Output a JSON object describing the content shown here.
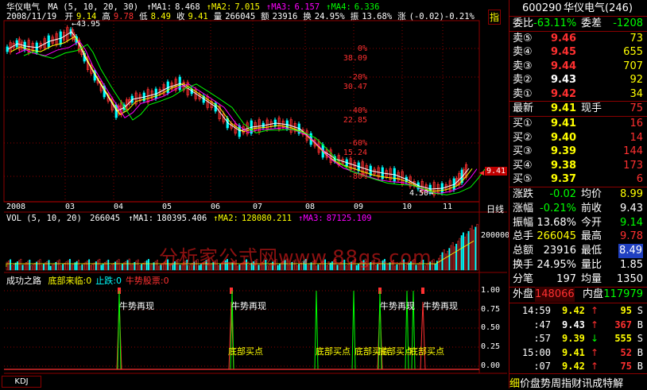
{
  "main_chart": {
    "stock_name": "华仪电气",
    "ma_label": "MA (5, 10, 20, 30)",
    "ma_values": [
      {
        "label": "MA1:",
        "value": "8.468",
        "color": "#ffffff"
      },
      {
        "label": "MA2:",
        "value": "7.015",
        "color": "#ffff00"
      },
      {
        "label": "MA3:",
        "value": "6.157",
        "color": "#ff00ff"
      },
      {
        "label": "MA4:",
        "value": "6.336",
        "color": "#00ff00"
      }
    ],
    "date": "2008/11/19",
    "ohlc": [
      {
        "label": "开",
        "value": "9.14",
        "color": "#ffff00"
      },
      {
        "label": "高",
        "value": "9.78",
        "color": "#ff3030"
      },
      {
        "label": "低",
        "value": "8.49",
        "color": "#ffff00"
      },
      {
        "label": "收",
        "value": "9.41",
        "color": "#ffff00"
      },
      {
        "label": "量",
        "value": "266045",
        "color": "#ffffff"
      },
      {
        "label": "额",
        "value": "23916",
        "color": "#ffffff"
      },
      {
        "label": "换",
        "value": "24.95%",
        "color": "#ffffff"
      },
      {
        "label": "振",
        "value": "13.68%",
        "color": "#ffffff"
      },
      {
        "label": "涨",
        "value": "(-0.02)-0.21%",
        "color": "#ffffff"
      }
    ],
    "indicator_tab": "指",
    "high_label": "43.95",
    "low_label": "4.50",
    "current_price_tag": "9.41",
    "right_axis": [
      {
        "pct": "0%",
        "price": "38.09"
      },
      {
        "pct": "-20%",
        "price": "30.47"
      },
      {
        "pct": "-40%",
        "price": "22.85"
      },
      {
        "pct": "-60%",
        "price": "15.24"
      },
      {
        "pct": "-80%",
        "price": ""
      }
    ],
    "x_labels": [
      "2008",
      "03",
      "04",
      "05",
      "06",
      "07",
      "08",
      "09",
      "10",
      "11"
    ],
    "period_label": "日线"
  },
  "volume_chart": {
    "label": "VOL (5, 10, 20)",
    "value": "266045",
    "ma": [
      {
        "label": "MA1:",
        "value": "180395.406",
        "color": "#ffffff"
      },
      {
        "label": "MA2:",
        "value": "128080.211",
        "color": "#ffff00"
      },
      {
        "label": "MA3:",
        "value": "87125.109",
        "color": "#ff00ff"
      }
    ],
    "axis_label": "200000",
    "watermark": "分析家公式网www.88gs.com"
  },
  "signal_chart": {
    "title": "成功之路",
    "legend": [
      {
        "label": "底部来临:",
        "value": "0",
        "color": "#ffff00"
      },
      {
        "label": "止跌:",
        "value": "0",
        "color": "#00ffff"
      },
      {
        "label": "牛势股票:",
        "value": "0",
        "color": "#ff3030"
      }
    ],
    "axis": [
      "1.00",
      "0.75",
      "0.50",
      "0.25",
      "0.00"
    ],
    "signal_text_top": "牛势再现",
    "signal_text_bottom": "底部买点",
    "kdj_tab": "KDJ"
  },
  "quote_panel": {
    "code": "600290",
    "name": "华仪电气(246)",
    "weibi_label": "委比",
    "weibi_value": "-63.11%",
    "weicha_label": "委差",
    "weicha_value": "-1208",
    "sell": [
      {
        "label": "卖⑤",
        "price": "9.46",
        "vol": "73"
      },
      {
        "label": "卖④",
        "price": "9.45",
        "vol": "655"
      },
      {
        "label": "卖③",
        "price": "9.44",
        "vol": "707"
      },
      {
        "label": "卖②",
        "price": "9.43",
        "vol": "92"
      },
      {
        "label": "卖①",
        "price": "9.42",
        "vol": "34"
      }
    ],
    "last_label": "最新",
    "last_price": "9.41",
    "now_hand_label": "现手",
    "now_hand": "75",
    "buy": [
      {
        "label": "买①",
        "price": "9.41",
        "vol": "16"
      },
      {
        "label": "买②",
        "price": "9.40",
        "vol": "14"
      },
      {
        "label": "买③",
        "price": "9.39",
        "vol": "144"
      },
      {
        "label": "买④",
        "price": "9.38",
        "vol": "173"
      },
      {
        "label": "买⑤",
        "price": "9.37",
        "vol": "6"
      }
    ],
    "stats": [
      {
        "l1": "涨跌",
        "v1": "-0.02",
        "l2": "均价",
        "v2": "8.99",
        "c1": "#00ff00",
        "c2": "#ffff00"
      },
      {
        "l1": "涨幅",
        "v1": "-0.21%",
        "l2": "前收",
        "v2": "9.43",
        "c1": "#00ff00",
        "c2": "#ffffff"
      },
      {
        "l1": "振幅",
        "v1": "13.68%",
        "l2": "今开",
        "v2": "9.14",
        "c1": "#ffffff",
        "c2": "#00ff00"
      },
      {
        "l1": "总手",
        "v1": "266045",
        "l2": "最高",
        "v2": "9.78",
        "c1": "#ffff00",
        "c2": "#ff3030"
      },
      {
        "l1": "总额",
        "v1": "23916",
        "l2": "最低",
        "v2": "8.49",
        "c1": "#ffffff",
        "c2": "#00ff00"
      },
      {
        "l1": "换手",
        "v1": "24.95%",
        "l2": "量比",
        "v2": "1.85",
        "c1": "#ffffff",
        "c2": "#ffffff"
      },
      {
        "l1": "分笔",
        "v1": "197",
        "l2": "均量",
        "v2": "1350",
        "c1": "#ffffff",
        "c2": "#ffffff"
      }
    ],
    "outer_label": "外盘",
    "outer_value": "148066",
    "inner_label": "内盘",
    "inner_value": "117979",
    "ticks": [
      {
        "time": "14:59",
        "price": "9.42",
        "arrow": "↑",
        "vol": "95",
        "side": "S",
        "pc": "#ffff00",
        "vc": "#ffff00"
      },
      {
        "time": ":47",
        "price": "9.43",
        "arrow": "↑",
        "vol": "367",
        "side": "B",
        "pc": "#ffffff",
        "vc": "#ff3030"
      },
      {
        "time": ":57",
        "price": "9.39",
        "arrow": "↓",
        "vol": "555",
        "side": "S",
        "pc": "#ffff00",
        "vc": "#ffff00"
      },
      {
        "time": "15:00",
        "price": "9.41",
        "arrow": "↑",
        "vol": "52",
        "side": "B",
        "pc": "#ffff00",
        "vc": "#ff3030"
      },
      {
        "time": ":07",
        "price": "9.42",
        "arrow": "↑",
        "vol": "75",
        "side": "B",
        "pc": "#ffff00",
        "vc": "#ff3030"
      }
    ],
    "bottom_tabs": [
      "细",
      "价",
      "盘",
      "势",
      "周",
      "指",
      "财",
      "讯",
      "成",
      "特",
      "解"
    ]
  }
}
